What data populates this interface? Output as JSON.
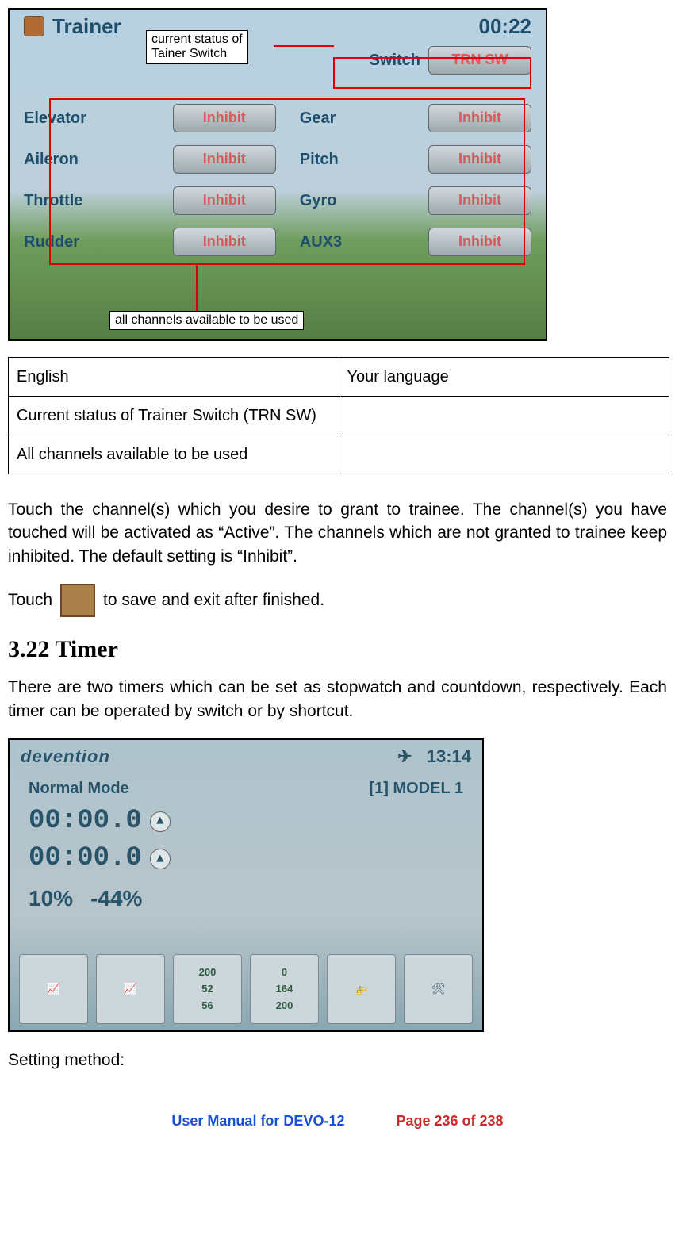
{
  "trainer_screen": {
    "title": "Trainer",
    "clock": "00:22",
    "switch_label": "Switch",
    "switch_value": "TRN SW",
    "callout_top": "current status of\nTainer Switch",
    "callout_bottom": "all channels available to be used",
    "channels_left": [
      "Elevator",
      "Aileron",
      "Throttle",
      "Rudder"
    ],
    "channels_right": [
      "Gear",
      "Pitch",
      "Gyro",
      "AUX3"
    ],
    "btn_label": "Inhibit"
  },
  "table": {
    "head_left": "English",
    "head_right": "Your language",
    "row1_left": "Current status of Trainer Switch (TRN SW)",
    "row1_right": "",
    "row2_left": "All channels available to be used",
    "row2_right": ""
  },
  "body": {
    "para1": "Touch the channel(s) which you desire to grant to trainee. The channel(s) you have touched will be activated as “Active”. The channels which are not granted to trainee keep inhibited. The default setting is “Inhibit”.",
    "touch_prefix": "Touch",
    "touch_suffix": "to save and exit after finished.",
    "heading": "3.22 Timer",
    "para2": "There are two timers which can be set as stopwatch and countdown, respectively. Each timer can be operated by switch or by shortcut.",
    "setting_method": "Setting method:"
  },
  "timer_screen": {
    "brand": "devention",
    "clock": "13:14",
    "mode_label": "Normal Mode",
    "model_label": "[1] MODEL 1",
    "timer_value": "00:00.0",
    "pct1": "10%",
    "pct2": "-44%",
    "mini_numbers_a": [
      "200",
      "52",
      "56"
    ],
    "mini_numbers_b": [
      "0",
      "164",
      "200"
    ]
  },
  "footer": {
    "manual": "User Manual for DEVO-12",
    "page": "Page 236 of 238"
  }
}
